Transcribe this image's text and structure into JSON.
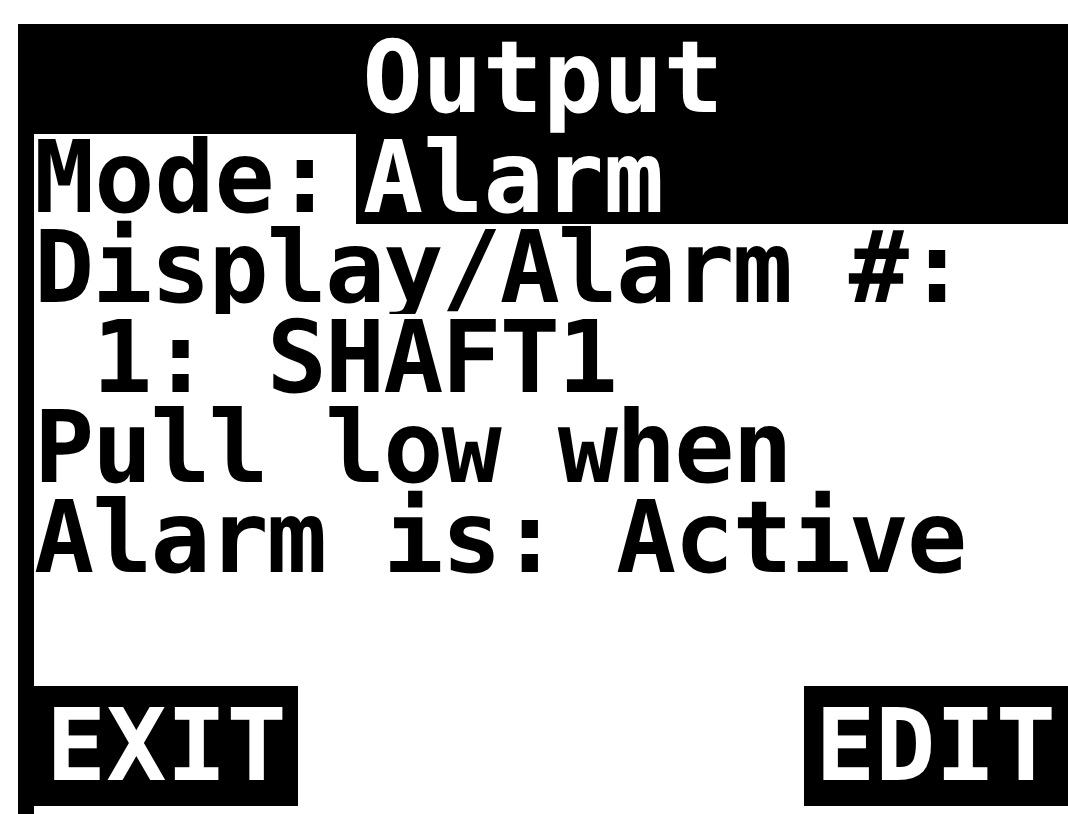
{
  "title": "Output",
  "mode": {
    "label": "Mode:",
    "value": "Alarm",
    "highlighted": true
  },
  "lines": [
    "Display/Alarm #:",
    " 1: SHAFT1",
    "Pull low when",
    "Alarm is: Active"
  ],
  "softkeys": [
    {
      "label": "EXIT"
    },
    {
      "label": "EDIT"
    }
  ]
}
